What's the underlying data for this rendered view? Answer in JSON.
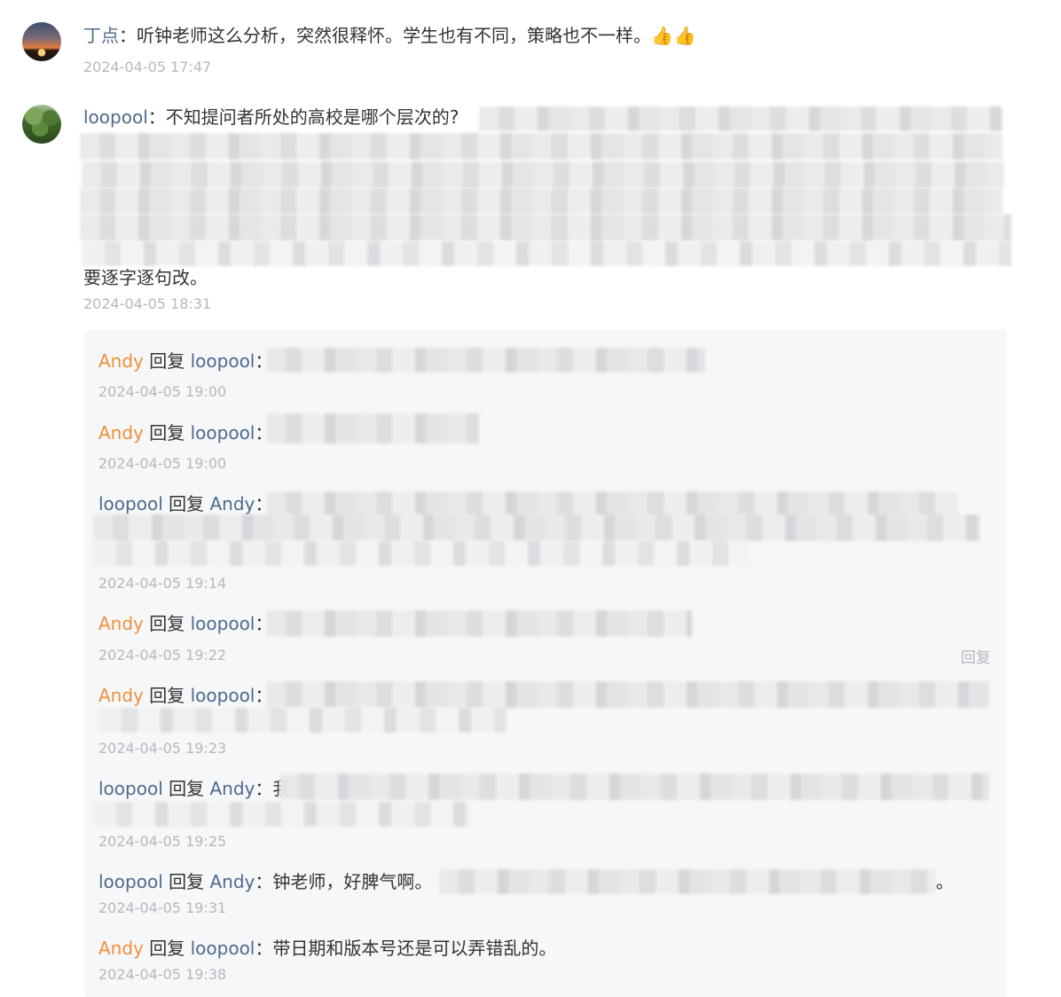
{
  "comments": [
    {
      "author": "丁点",
      "separator": "：",
      "text": "听钟老师这么分析，突然很释怀。学生也有不同，策略也不一样。",
      "emoji": "👍👍",
      "time": "2024-04-05 17:47"
    },
    {
      "author": "loopool",
      "separator": "：",
      "text": "不知提问者所处的高校是哪个层次的?",
      "tail": "要逐字逐句改。",
      "time": "2024-04-05 18:31"
    }
  ],
  "replies": [
    {
      "from": "Andy",
      "verb": "回复",
      "to": "loopool",
      "sep": "：",
      "text": "",
      "time": "2024-04-05 19:00"
    },
    {
      "from": "Andy",
      "verb": "回复",
      "to": "loopool",
      "sep": "：",
      "text": "",
      "time": "2024-04-05 19:00"
    },
    {
      "from": "loopool",
      "verb": "回复",
      "to": "Andy",
      "sep": "：",
      "text": "",
      "time": "2024-04-05 19:14"
    },
    {
      "from": "Andy",
      "verb": "回复",
      "to": "loopool",
      "sep": "：",
      "text": "",
      "time": "2024-04-05 19:22",
      "reply_label": "回复"
    },
    {
      "from": "Andy",
      "verb": "回复",
      "to": "loopool",
      "sep": "：",
      "text": "",
      "time": "2024-04-05 19:23"
    },
    {
      "from": "loopool",
      "verb": "回复",
      "to": "Andy",
      "sep": "：",
      "text": "我",
      "time": "2024-04-05 19:25"
    },
    {
      "from": "loopool",
      "verb": "回复",
      "to": "Andy",
      "sep": "：",
      "text": "钟老师，好脾气啊。",
      "tail": "。",
      "time": "2024-04-05 19:31"
    },
    {
      "from": "Andy",
      "verb": "回复",
      "to": "loopool",
      "sep": "：",
      "text": "带日期和版本号还是可以弄错乱的。",
      "time": "2024-04-05 19:38"
    }
  ],
  "colors": {
    "author_blue": "#4e6a8c",
    "author_orange": "#f08f3a",
    "timestamp": "#b5b8bd",
    "panel_bg": "#f6f7f9"
  }
}
